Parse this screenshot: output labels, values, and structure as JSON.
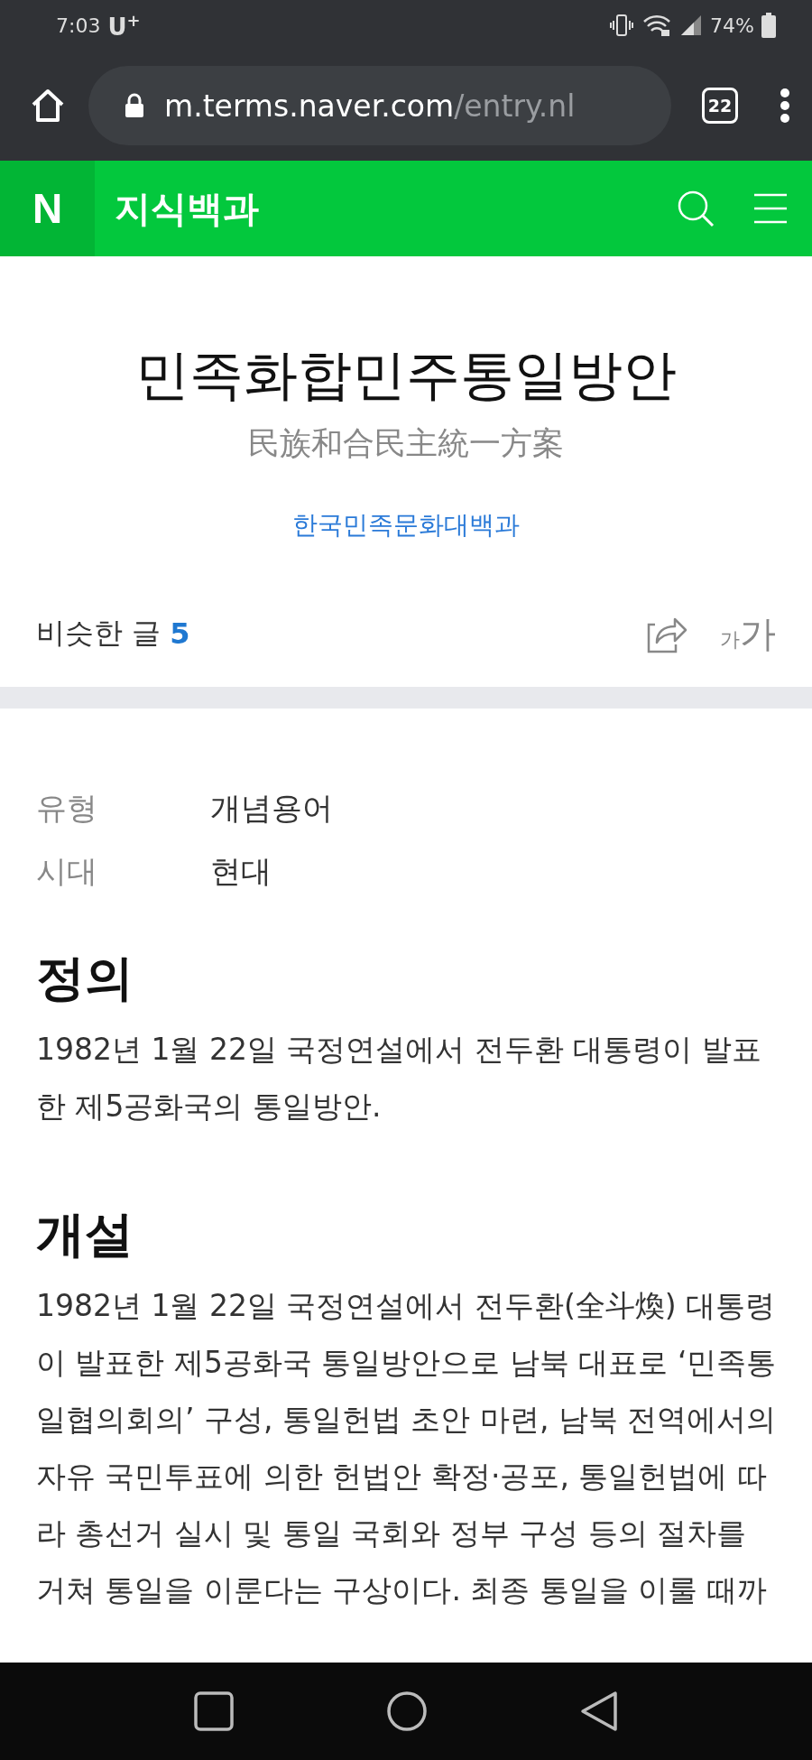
{
  "status_bar": {
    "time": "7:03",
    "carrier": "U$^{+}$",
    "battery": "74%"
  },
  "browser": {
    "url_host": "m.terms.naver.com",
    "url_path": "/entry.nl",
    "tab_count": "22"
  },
  "site_header": {
    "logo": "N",
    "title": "지식백과"
  },
  "entry": {
    "title": "민족화합민주통일방안",
    "hanja": "民族和合民主統一方案",
    "source": "한국민족문화대백과",
    "similar_label": "비슷한 글",
    "similar_count": "5",
    "font_small": "가",
    "font_large": "가"
  },
  "info": [
    {
      "label": "유형",
      "value": "개념용어"
    },
    {
      "label": "시대",
      "value": "현대"
    }
  ],
  "sections": [
    {
      "heading": "정의",
      "text": "1982년 1월 22일 국정연설에서 전두환 대통령이 발표한 제5공화국의 통일방안."
    },
    {
      "heading": "개설",
      "text": "1982년 1월 22일 국정연설에서 전두환(全斗煥) 대통령이 발표한 제5공화국 통일방안으로 남북 대표로 ‘민족통일협의회의’ 구성, 통일헌법 초안 마련, 남북 전역에서의 자유 국민투표에 의한 헌법안 확정·공포, 통일헌법에 따라 총선거 실시 및 통일 국회와 정부 구성 등의 절차를 거쳐 통일을 이룬다는 구상이다. 최종 통일을 이룰 때까"
    }
  ]
}
